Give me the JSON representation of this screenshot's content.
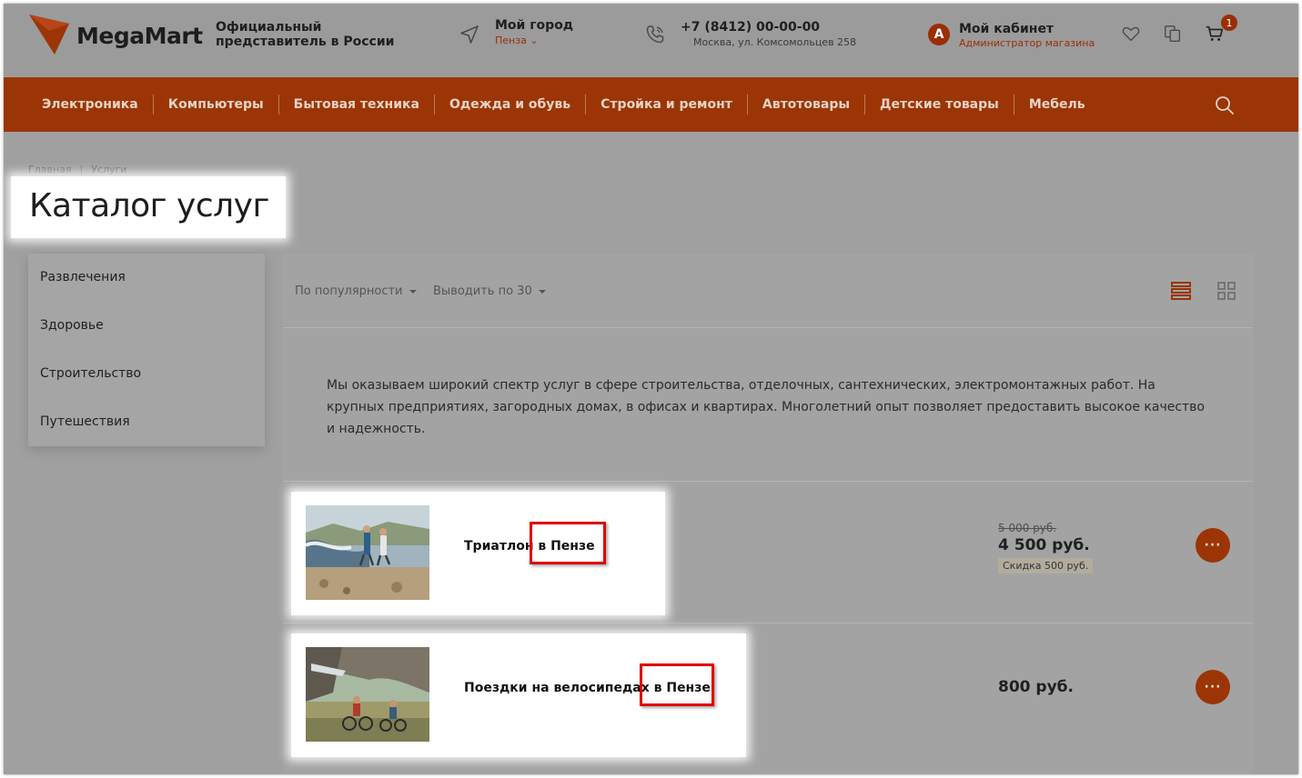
{
  "header": {
    "logo_text": "MegaMart",
    "tagline_line1": "Официальный",
    "tagline_line2": "представитель в России",
    "city_title": "Мой город",
    "city_value": "Пенза",
    "phone": "+7 (8412) 00-00-00",
    "address": "Москва, ул. Комсомольцев 258",
    "cabinet_avatar": "A",
    "cabinet_title": "Мой кабинет",
    "cabinet_subtitle": "Администратор магазина",
    "cart_count": "1",
    "icons": [
      "location-arrow-icon",
      "phone-icon",
      "heart-icon",
      "compare-icon",
      "cart-icon"
    ],
    "accent_color": "#9b3505"
  },
  "nav": {
    "items": [
      "Электроника",
      "Компьютеры",
      "Бытовая техника",
      "Одежда и обувь",
      "Стройка и ремонт",
      "Автотовары",
      "Детские товары",
      "Мебель"
    ]
  },
  "breadcrumb": {
    "home": "Главная",
    "current": "Услуги"
  },
  "page_title": "Каталог услуг",
  "sidebar": {
    "items": [
      "Развлечения",
      "Здоровье",
      "Строительство",
      "Путешествия"
    ]
  },
  "toolbar": {
    "sort_label": "По популярности",
    "per_page_label": "Выводить по 30"
  },
  "description": "Мы оказываем широкий спектр услуг в сфере строительства, отделочных, сантехнических, электромонтажных работ. На крупных предприятиях, загородных домах, в офисах и квартирах. Многолетний опыт позволяет предоставить высокое качество и надежность.",
  "services": [
    {
      "name": "Триатлон в Пензе",
      "highlight": "в Пензе",
      "price_old": "5 000 руб.",
      "price": "4 500 руб.",
      "discount": "Скидка 500 руб.",
      "more": "···"
    },
    {
      "name": "Поездки на велосипедах в Пензе",
      "highlight": "в Пензе",
      "price": "800 руб.",
      "more": "···"
    }
  ]
}
